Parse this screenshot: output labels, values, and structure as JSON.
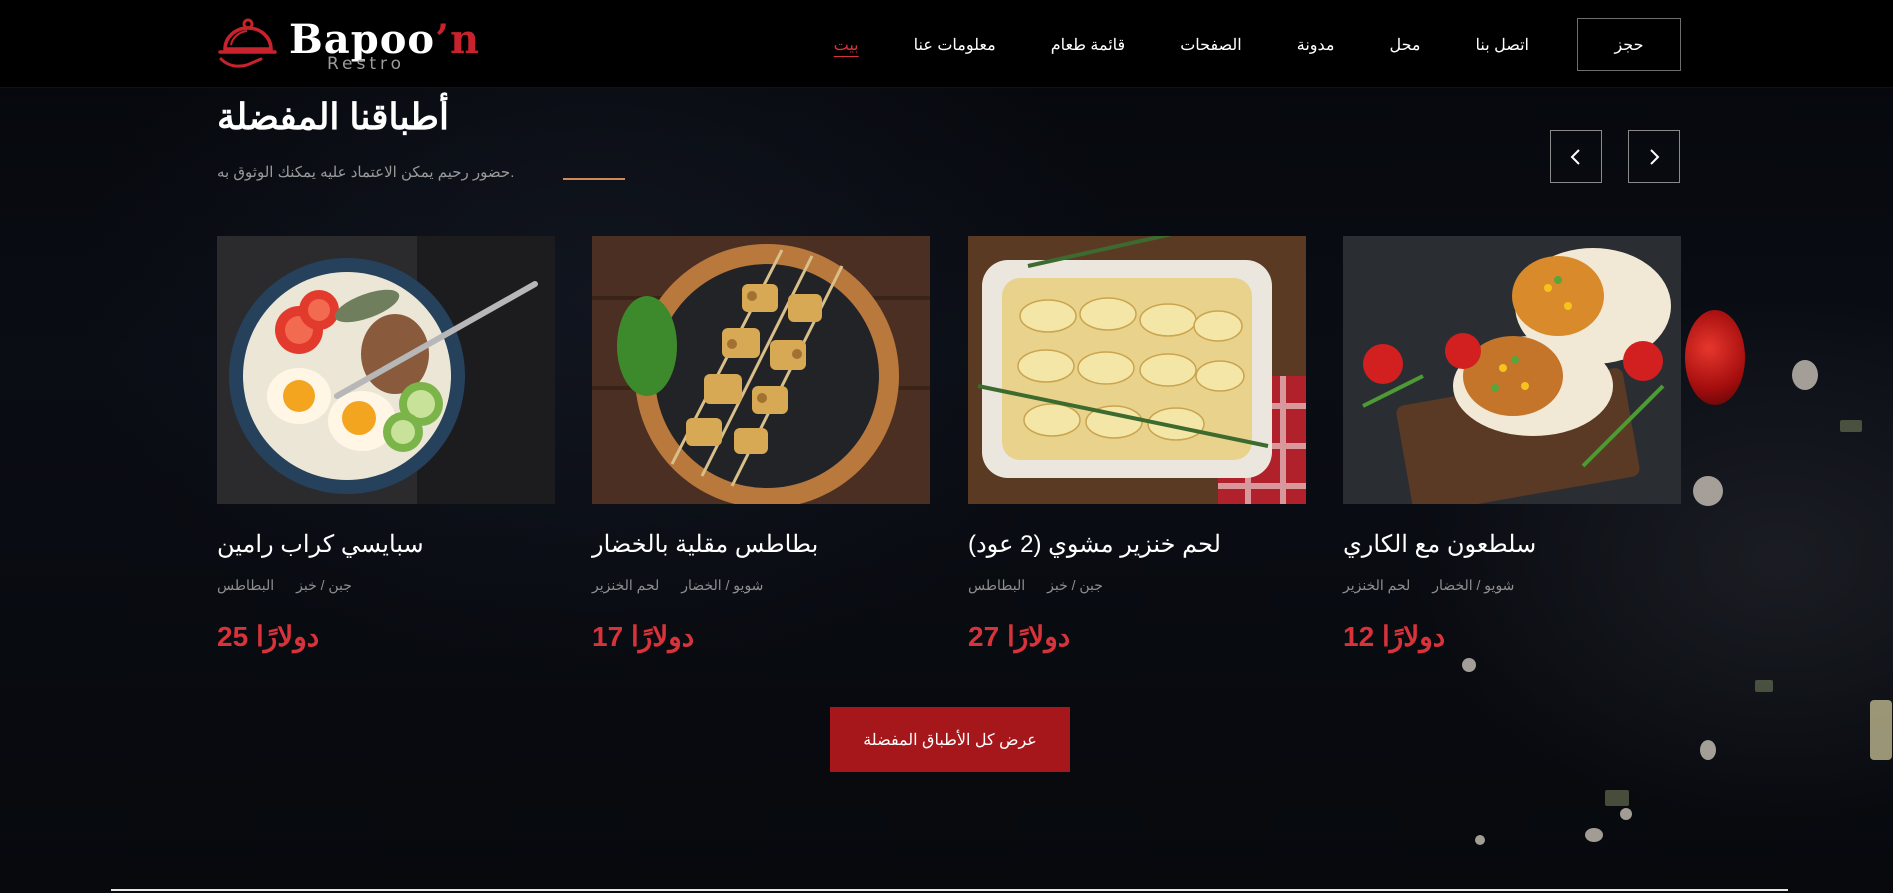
{
  "brand": {
    "name_main": "Bapoo",
    "name_apostrophe": "’n",
    "name_sub": "Restro"
  },
  "nav": {
    "book_label": "حجز",
    "items": [
      "اتصل بنا",
      "محل",
      "مدونة",
      "الصفحات",
      "قائمة طعام",
      "معلومات عنا",
      "بيت"
    ],
    "active": "بيت"
  },
  "section": {
    "title": "أطباقنا المفضلة",
    "subtitle": "حضور رحيم يمكن الاعتماد عليه يمكنك الوثوق به.",
    "accent_color": "#d08a55"
  },
  "carousel": {
    "prev_icon": "chevron-left-icon",
    "next_icon": "chevron-right-icon"
  },
  "dishes": [
    {
      "title": "سلطعون مع الكاري",
      "tags": [
        "شويو / الخضار",
        "لحم الخنزير"
      ],
      "price": "12 دولارًا"
    },
    {
      "title": "لحم خنزير مشوي (2 عود)",
      "tags": [
        "جبن / خبز",
        "البطاطس"
      ],
      "price": "27 دولارًا"
    },
    {
      "title": "بطاطس مقلية بالخضار",
      "tags": [
        "شويو / الخضار",
        "لحم الخنزير"
      ],
      "price": "17 دولارًا"
    },
    {
      "title": "سبايسي كراب رامين",
      "tags": [
        "جبن / خبز",
        "البطاطس"
      ],
      "price": "25 دولارًا"
    }
  ],
  "cta": {
    "label": "عرض كل الأطباق المفضلة"
  },
  "colors": {
    "accent_red": "#d8323a",
    "button_red": "#a6171c",
    "background": "#05070b"
  }
}
